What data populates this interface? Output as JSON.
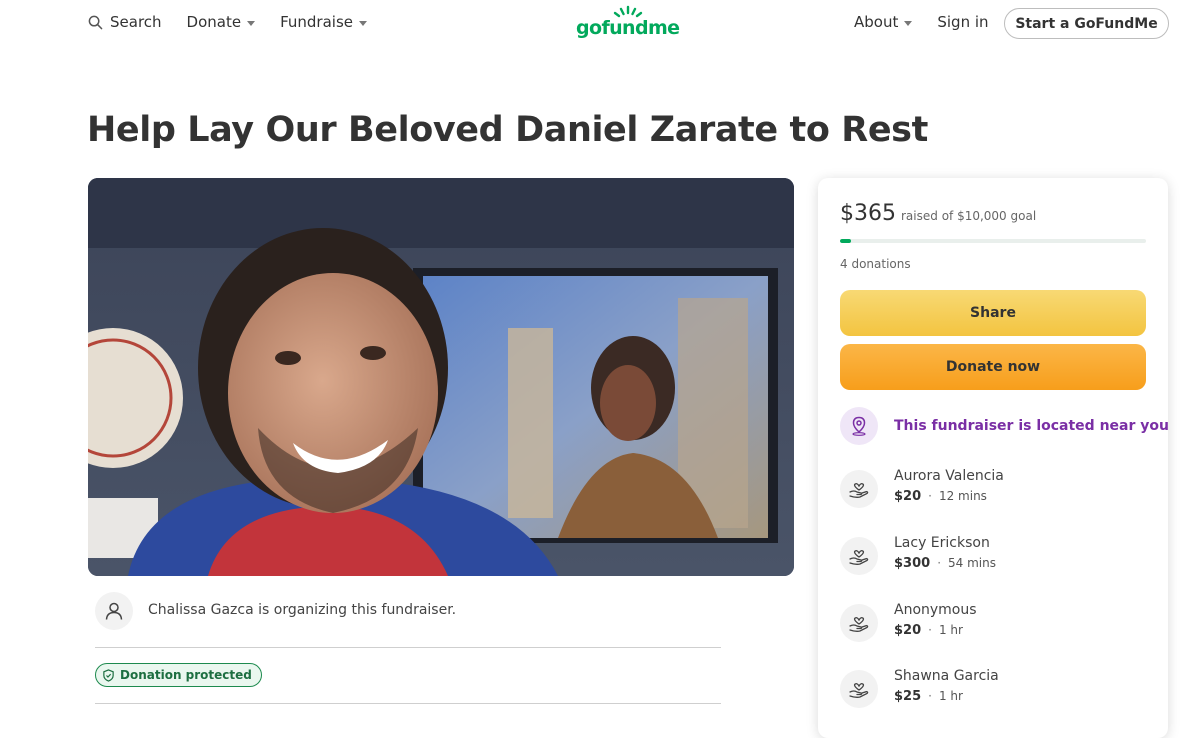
{
  "header": {
    "search_label": "Search",
    "donate_label": "Donate",
    "fundraise_label": "Fundraise",
    "logo_text": "gofundme",
    "about_label": "About",
    "signin_label": "Sign in",
    "start_label": "Start a GoFundMe"
  },
  "campaign": {
    "title": "Help Lay Our Beloved Daniel Zarate to Rest",
    "organizer_text": "Chalissa Gazca is organizing this fundraiser.",
    "protected_label": "Donation protected"
  },
  "sidebar": {
    "raised_amount": "$365",
    "raised_of": "raised of $10,000 goal",
    "progress_fraction": 0.0365,
    "donation_count": "4 donations",
    "share_label": "Share",
    "donate_now_label": "Donate now",
    "nearby_text": "This fundraiser is located near you",
    "donors": [
      {
        "name": "Aurora Valencia",
        "amount": "$20",
        "time": "12 mins"
      },
      {
        "name": "Lacy Erickson",
        "amount": "$300",
        "time": "54 mins"
      },
      {
        "name": "Anonymous",
        "amount": "$20",
        "time": "1 hr"
      },
      {
        "name": "Shawna Garcia",
        "amount": "$25",
        "time": "1 hr"
      }
    ]
  },
  "colors": {
    "brand_green": "#02a95c",
    "share_yellow": "#f3c440",
    "donate_orange": "#f79e1b",
    "nearby_purple": "#7a2fa5"
  }
}
